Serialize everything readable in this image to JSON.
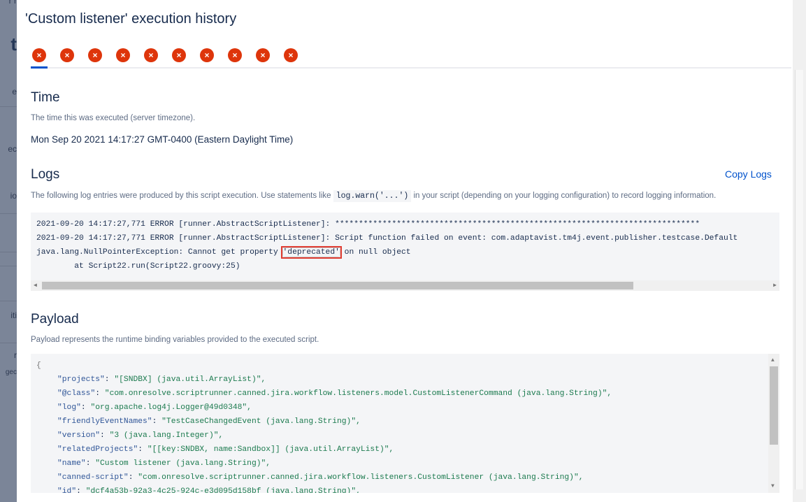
{
  "backdrop": {
    "fragments": [
      "r r",
      "t",
      "e",
      "ec",
      "io",
      "iti",
      "r",
      "gec"
    ]
  },
  "modal": {
    "title": "'Custom listener' execution history",
    "tabs": [
      {
        "status": "error"
      },
      {
        "status": "error"
      },
      {
        "status": "error"
      },
      {
        "status": "error"
      },
      {
        "status": "error"
      },
      {
        "status": "error"
      },
      {
        "status": "error"
      },
      {
        "status": "error"
      },
      {
        "status": "error"
      },
      {
        "status": "error"
      }
    ],
    "tab_icon": "×"
  },
  "time": {
    "heading": "Time",
    "description": "The time this was executed (server timezone).",
    "value": "Mon Sep 20 2021 14:17:27 GMT-0400 (Eastern Daylight Time)"
  },
  "logs": {
    "heading": "Logs",
    "copy_label": "Copy Logs",
    "desc_before": "The following log entries were produced by this script execution. Use statements like",
    "desc_code": "log.warn('...')",
    "desc_after": "in your script (depending on your logging configuration) to record logging information.",
    "lines": [
      "2021-09-20 14:17:27,771 ERROR [runner.AbstractScriptListener]: *****************************************************************************",
      "2021-09-20 14:17:27,771 ERROR [runner.AbstractScriptListener]: Script function failed on event: com.adaptavist.tm4j.event.publisher.testcase.Default",
      "        at Script22.run(Script22.groovy:25)"
    ],
    "npe_before": "java.lang.NullPointerException: Cannot get property ",
    "npe_highlight": "'deprecated'",
    "npe_after": " on null object"
  },
  "payload": {
    "heading": "Payload",
    "description": "Payload represents the runtime binding variables provided to the executed script.",
    "open_brace": "{",
    "entries": [
      {
        "key": "\"projects\"",
        "value": "\"[SNDBX] (java.util.ArrayList)\","
      },
      {
        "key": "\"@class\"",
        "value": "\"com.onresolve.scriptrunner.canned.jira.workflow.listeners.model.CustomListenerCommand (java.lang.String)\","
      },
      {
        "key": "\"log\"",
        "value": "\"org.apache.log4j.Logger@49d0348\","
      },
      {
        "key": "\"friendlyEventNames\"",
        "value": "\"TestCaseChangedEvent (java.lang.String)\","
      },
      {
        "key": "\"version\"",
        "value": "\"3 (java.lang.Integer)\","
      },
      {
        "key": "\"relatedProjects\"",
        "value": "\"[[key:SNDBX, name:Sandbox]] (java.util.ArrayList)\","
      },
      {
        "key": "\"name\"",
        "value": "\"Custom listener (java.lang.String)\","
      },
      {
        "key": "\"canned-script\"",
        "value": "\"com.onresolve.scriptrunner.canned.jira.workflow.listeners.CustomListener (java.lang.String)\","
      },
      {
        "key": "\"id\"",
        "value": "\"dcf4a53b-92a3-4c25-924c-e3d095d158bf (java.lang.String)\","
      }
    ]
  },
  "colors": {
    "error": "#de350b",
    "accent": "#0052cc",
    "code_key": "#2f5597",
    "code_value": "#1b7a4e"
  }
}
